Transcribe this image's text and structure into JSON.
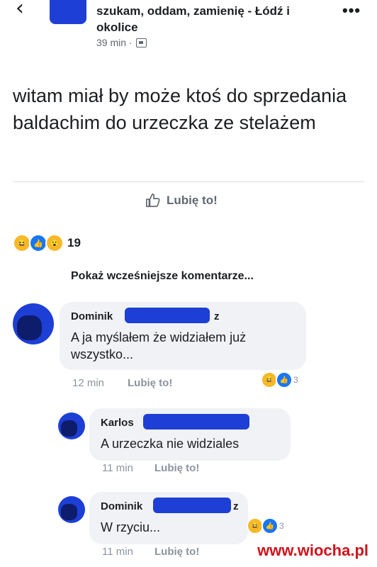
{
  "header": {
    "group_name": "szukam, oddam, zamienię - Łódź i okolice",
    "post_time": "39 min ·",
    "more": "•••"
  },
  "post": {
    "text": "witam miał by może ktoś do sprzedania baldachim do urzeczka ze stelażem",
    "like_label": "Lubię to!",
    "reaction_count": "19"
  },
  "previous_comments": "Pokaż wcześniejsze komentarze...",
  "comments": [
    {
      "name": "Dominik",
      "name_suffix": "z",
      "text_line1": "A ja myślałem że widziałem już",
      "text_line2": "wszystko...",
      "time": "12 min",
      "like": "Lubię to!",
      "reactions": "3"
    },
    {
      "name": "Karlos",
      "text": "A urzeczka nie widziales",
      "time": "11 min",
      "like": "Lubię to!"
    },
    {
      "name": "Dominik",
      "name_suffix": "z",
      "text": "W rzyciu...",
      "time": "11 min",
      "like": "Lubię to!",
      "reactions": "3"
    }
  ],
  "watermark": "www.wiocha.pl",
  "colors": {
    "accent_blue": "#1877f2",
    "redaction": "#1d3fd6",
    "bubble": "#f0f2f5",
    "meta_text": "#8d949e",
    "watermark": "#d0121b"
  },
  "icons": [
    "back-arrow-icon",
    "globe-icon",
    "more-icon",
    "thumb-up-icon",
    "haha-reaction-icon",
    "like-reaction-icon",
    "wow-reaction-icon"
  ]
}
